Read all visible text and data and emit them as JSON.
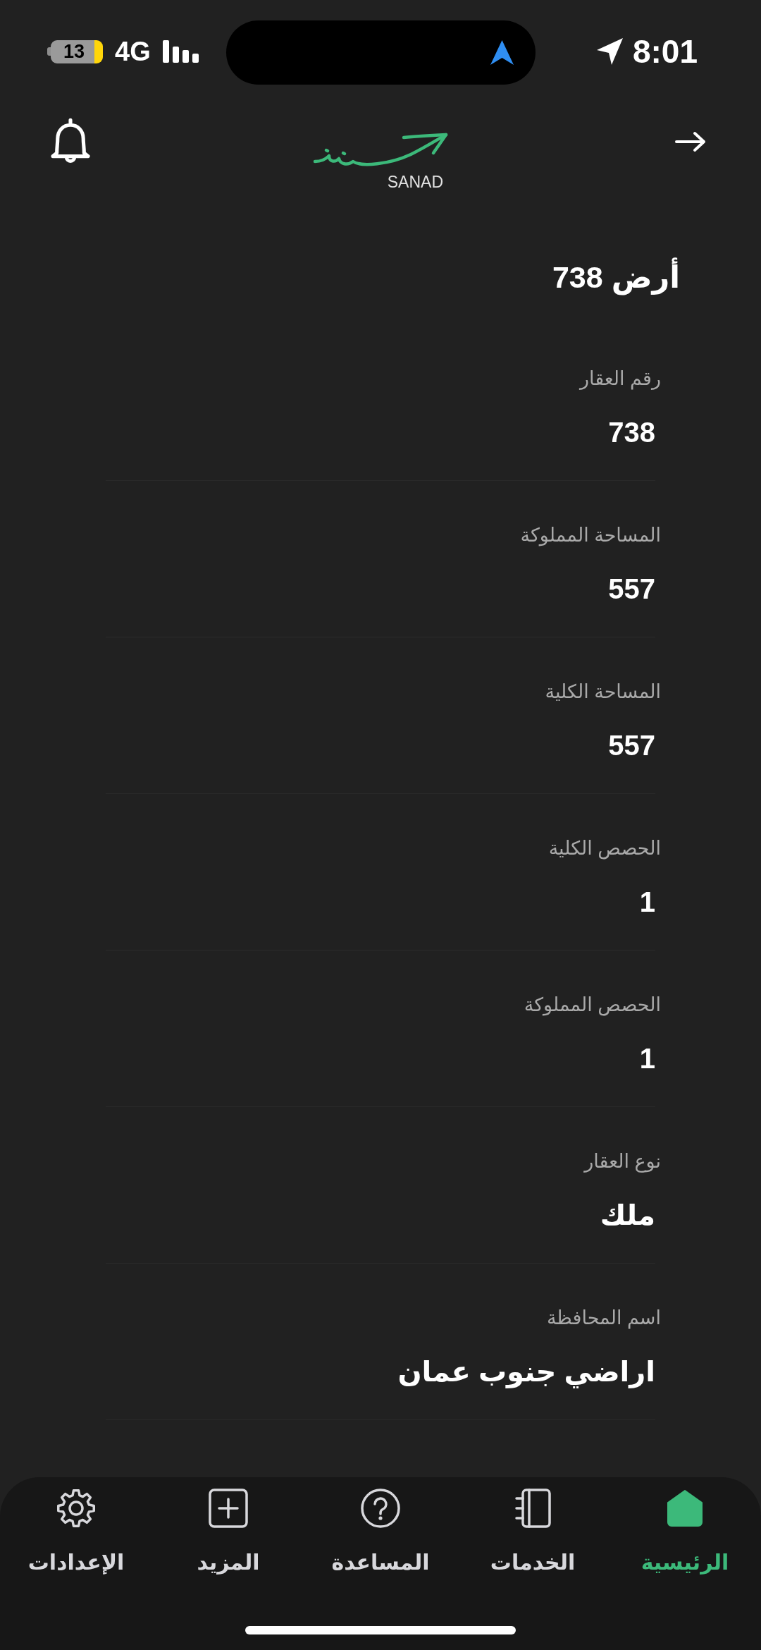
{
  "status_bar": {
    "battery": "13",
    "network": "4G",
    "time": "8:01"
  },
  "header": {
    "logo_text": "SANAD"
  },
  "property": {
    "title": "أرض 738",
    "fields": [
      {
        "label": "رقم العقار",
        "value": "738"
      },
      {
        "label": "المساحة المملوكة",
        "value": "557"
      },
      {
        "label": "المساحة الكلية",
        "value": "557"
      },
      {
        "label": "الحصص الكلية",
        "value": "1"
      },
      {
        "label": "الحصص المملوكة",
        "value": "1"
      },
      {
        "label": "نوع العقار",
        "value": "ملك"
      },
      {
        "label": "اسم المحافظة",
        "value": "اراضي جنوب عمان"
      }
    ]
  },
  "tab_bar": {
    "items": [
      {
        "label": "الرئيسية",
        "selected": true
      },
      {
        "label": "الخدمات",
        "selected": false
      },
      {
        "label": "المساعدة",
        "selected": false
      },
      {
        "label": "المزيد",
        "selected": false
      },
      {
        "label": "الإعدادات",
        "selected": false
      }
    ]
  }
}
